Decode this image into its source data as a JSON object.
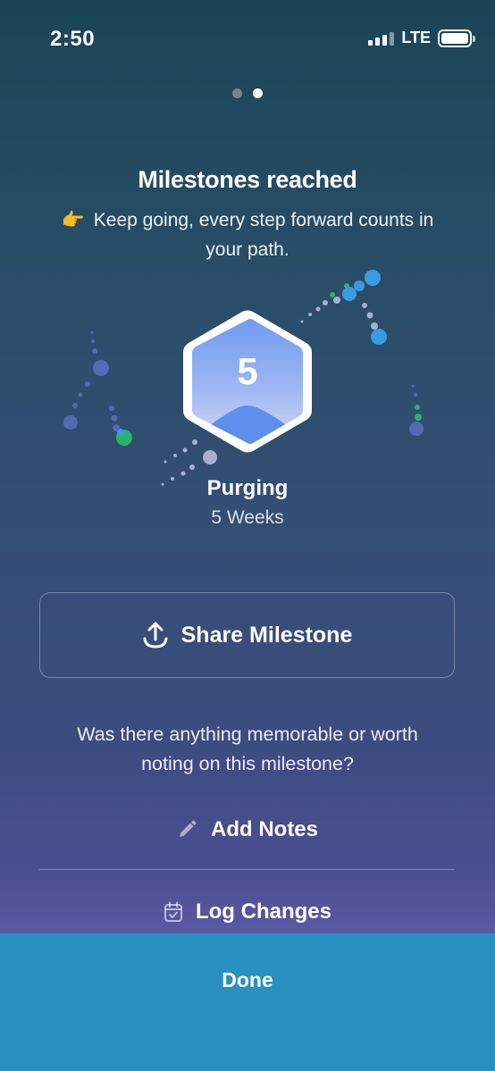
{
  "status_bar": {
    "time": "2:50",
    "network": "LTE"
  },
  "pager": {
    "total": 2,
    "active_index": 1
  },
  "header": {
    "title": "Milestones reached",
    "subtitle_emoji": "👉",
    "subtitle": "Keep going, every step forward counts in your path."
  },
  "badge": {
    "number": "5",
    "colors": {
      "top": "#6f9bf0",
      "bottom": "#c3cdf3",
      "mountain": "#5e8fef",
      "border": "#ffffff"
    }
  },
  "milestone": {
    "name": "Purging",
    "duration": "5 Weeks"
  },
  "share": {
    "label": "Share Milestone",
    "icon": "share-upload-icon"
  },
  "notes_prompt": "Was there anything memorable or worth noting on this milestone?",
  "actions": {
    "add_notes_label": "Add Notes",
    "add_notes_icon": "pencil-icon",
    "log_changes_label": "Log Changes",
    "log_changes_icon": "calendar-check-icon"
  },
  "footer": {
    "done_label": "Done",
    "color": "#2a8fc1"
  },
  "confetti_colors": [
    "#5a6fc4",
    "#2bb36a",
    "#3b9be0",
    "#9aa4c8",
    "#6a6fb8"
  ]
}
